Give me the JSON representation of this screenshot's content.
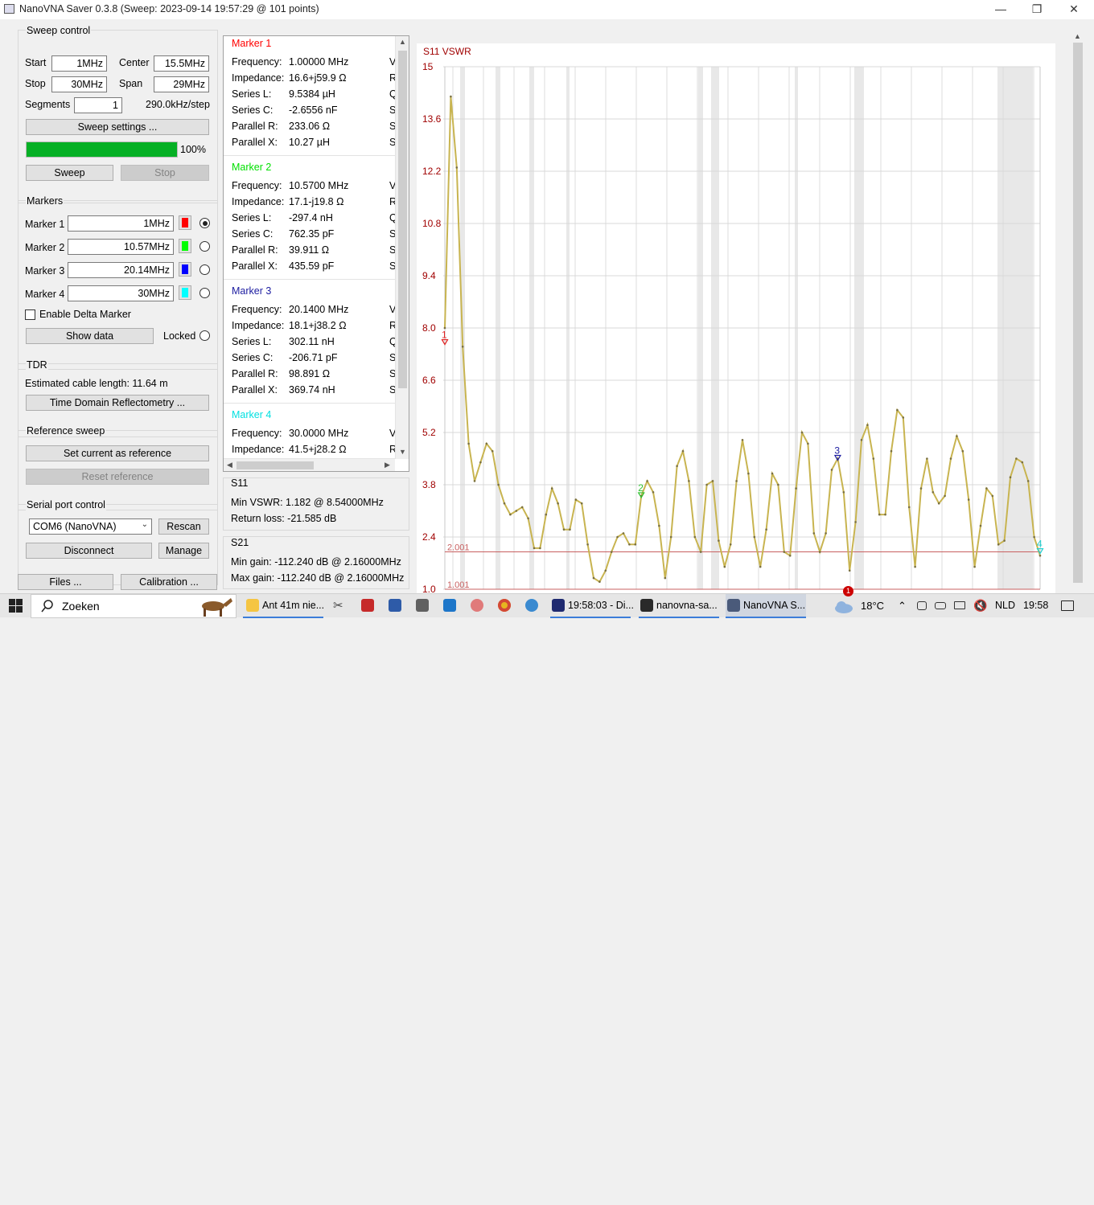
{
  "window": {
    "title": "NanoVNA Saver 0.3.8 (Sweep: 2023-09-14 19:57:29 @ 101 points)",
    "minimize": "—",
    "restore": "❐",
    "close": "✕"
  },
  "sweep_control": {
    "title": "Sweep control",
    "start_label": "Start",
    "start_value": "1MHz",
    "center_label": "Center",
    "center_value": "15.5MHz",
    "stop_label": "Stop",
    "stop_value": "30MHz",
    "span_label": "Span",
    "span_value": "29MHz",
    "segments_label": "Segments",
    "segments_value": "1",
    "step_text": "290.0kHz/step",
    "settings_button": "Sweep settings ...",
    "progress": 100,
    "progress_text": "100%",
    "sweep_button": "Sweep",
    "stop_button": "Stop"
  },
  "markers": {
    "title": "Markers",
    "items": [
      {
        "label": "Marker 1",
        "value": "1MHz",
        "color": "#ff0000",
        "selected": true
      },
      {
        "label": "Marker 2",
        "value": "10.57MHz",
        "color": "#00ff00",
        "selected": false
      },
      {
        "label": "Marker 3",
        "value": "20.14MHz",
        "color": "#0000ff",
        "selected": false
      },
      {
        "label": "Marker 4",
        "value": "30MHz",
        "color": "#00ffff",
        "selected": false
      }
    ],
    "delta_label": "Enable Delta Marker",
    "show_data_button": "Show data",
    "locked_label": "Locked"
  },
  "tdr": {
    "title": "TDR",
    "cable_length_text": "Estimated cable length: 11.64 m",
    "button": "Time Domain Reflectometry ..."
  },
  "reference": {
    "title": "Reference sweep",
    "set_button": "Set current as reference",
    "reset_button": "Reset reference"
  },
  "serial": {
    "title": "Serial port control",
    "port": "COM6 (NanoVNA)",
    "rescan_button": "Rescan",
    "disconnect_button": "Disconnect",
    "manage_button": "Manage"
  },
  "bottom_buttons": {
    "files": "Files ...",
    "calibration": "Calibration ..."
  },
  "marker_details": [
    {
      "title": "Marker 1",
      "color": "#ff0000",
      "rows": [
        {
          "k": "Frequency:",
          "v": "1.00000 MHz",
          "c": "V"
        },
        {
          "k": "Impedance:",
          "v": "16.6+j59.9 Ω",
          "c": "R"
        },
        {
          "k": "Series L:",
          "v": "9.5384 µH",
          "c": "Q"
        },
        {
          "k": "Series C:",
          "v": "-2.6556 nF",
          "c": "S"
        },
        {
          "k": "Parallel R:",
          "v": "233.06 Ω",
          "c": "S"
        },
        {
          "k": "Parallel X:",
          "v": "10.27 µH",
          "c": "S"
        }
      ]
    },
    {
      "title": "Marker 2",
      "color": "#00e000",
      "rows": [
        {
          "k": "Frequency:",
          "v": "10.5700 MHz",
          "c": "V"
        },
        {
          "k": "Impedance:",
          "v": "17.1-j19.8 Ω",
          "c": "R"
        },
        {
          "k": "Series L:",
          "v": "-297.4 nH",
          "c": "Q"
        },
        {
          "k": "Series C:",
          "v": "762.35 pF",
          "c": "S"
        },
        {
          "k": "Parallel R:",
          "v": "39.911 Ω",
          "c": "S"
        },
        {
          "k": "Parallel X:",
          "v": "435.59 pF",
          "c": "S"
        }
      ]
    },
    {
      "title": "Marker 3",
      "color": "#1c1ca0",
      "rows": [
        {
          "k": "Frequency:",
          "v": "20.1400 MHz",
          "c": "V"
        },
        {
          "k": "Impedance:",
          "v": "18.1+j38.2 Ω",
          "c": "R"
        },
        {
          "k": "Series L:",
          "v": "302.11 nH",
          "c": "Q"
        },
        {
          "k": "Series C:",
          "v": "-206.71 pF",
          "c": "S"
        },
        {
          "k": "Parallel R:",
          "v": "98.891 Ω",
          "c": "S"
        },
        {
          "k": "Parallel X:",
          "v": "369.74 nH",
          "c": "S"
        }
      ]
    },
    {
      "title": "Marker 4",
      "color": "#00e0e0",
      "rows": [
        {
          "k": "Frequency:",
          "v": "30.0000 MHz",
          "c": "V"
        },
        {
          "k": "Impedance:",
          "v": "41.5+j28.2 Ω",
          "c": "R"
        }
      ]
    }
  ],
  "s11": {
    "title": "S11",
    "min_vswr": "Min VSWR:  1.182 @ 8.54000MHz",
    "return_loss": "Return loss:  -21.585 dB"
  },
  "s21": {
    "title": "S21",
    "min_gain": "Min gain:  -112.240 dB @ 2.16000MHz",
    "max_gain": "Max gain:  -112.240 dB @ 2.16000MHz"
  },
  "chart_data": {
    "type": "line",
    "title": "S11 VSWR",
    "y_ticks": [
      "15",
      "13.6",
      "12.2",
      "10.8",
      "9.4",
      "8.0",
      "6.6",
      "5.2",
      "3.8",
      "2.4",
      "1.0"
    ],
    "ylim": [
      1.0,
      15
    ],
    "xlim": [
      1,
      30
    ],
    "reference_lines": [
      {
        "label": "2.001",
        "value": 2.001
      },
      {
        "label": "1.001",
        "value": 1.001
      }
    ],
    "series": [
      {
        "color": "#c8b450",
        "x_start": 1,
        "x_step": 0.29,
        "values": [
          8.0,
          14.2,
          12.3,
          7.5,
          4.9,
          3.9,
          4.4,
          4.9,
          4.7,
          3.8,
          3.3,
          3.0,
          3.1,
          3.2,
          2.9,
          2.1,
          2.1,
          3.0,
          3.7,
          3.3,
          2.6,
          2.6,
          3.4,
          3.3,
          2.2,
          1.3,
          1.2,
          1.5,
          2.0,
          2.4,
          2.5,
          2.2,
          2.2,
          3.5,
          3.9,
          3.6,
          2.7,
          1.3,
          2.4,
          4.3,
          4.7,
          3.9,
          2.4,
          2.0,
          3.8,
          3.9,
          2.3,
          1.6,
          2.2,
          3.9,
          5.0,
          4.1,
          2.4,
          1.6,
          2.6,
          4.1,
          3.8,
          2.0,
          1.9,
          3.7,
          5.2,
          4.9,
          2.5,
          2.0,
          2.5,
          4.2,
          4.5,
          3.6,
          1.5,
          2.8,
          5.0,
          5.4,
          4.5,
          3.0,
          3.0,
          4.7,
          5.8,
          5.6,
          3.2,
          1.6,
          3.7,
          4.5,
          3.6,
          3.3,
          3.5,
          4.5,
          5.1,
          4.7,
          3.4,
          1.6,
          2.7,
          3.7,
          3.5,
          2.2,
          2.3,
          4.0,
          4.5,
          4.4,
          3.9,
          2.4,
          1.9
        ]
      }
    ],
    "markers": [
      {
        "label": "1",
        "x": 1.0,
        "vswr": 7.6,
        "color": "#e02020"
      },
      {
        "label": "2",
        "x": 10.57,
        "vswr": 3.5,
        "color": "#30c030"
      },
      {
        "label": "3",
        "x": 20.14,
        "vswr": 4.5,
        "color": "#1c1ca0"
      },
      {
        "label": "4",
        "x": 30.0,
        "vswr": 2.0,
        "color": "#20d0d0"
      }
    ]
  },
  "taskbar": {
    "search_placeholder": "Zoeken",
    "items": [
      {
        "label": "Ant 41m nie...",
        "color": "#f5c542"
      },
      {
        "label": "19:58:03 - Di...",
        "color": "#1f2a70"
      },
      {
        "label": "nanovna-sa...",
        "color": "#2a2a2a"
      },
      {
        "label": "NanoVNA S...",
        "color": "#4a5a7a"
      }
    ],
    "weather": "18°C",
    "weather_badge": "1",
    "language": "NLD",
    "time": "19:58"
  }
}
